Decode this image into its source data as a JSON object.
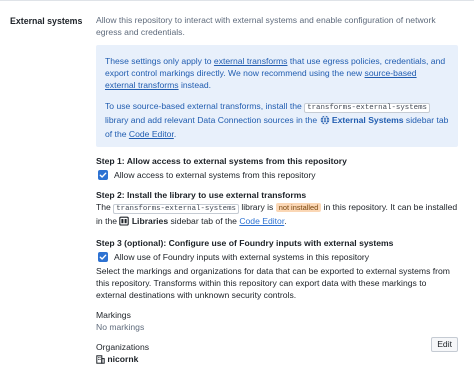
{
  "section": {
    "label": "External systems"
  },
  "intro": "Allow this repository to interact with external systems and enable configuration of network egress and credentials.",
  "callout": {
    "p1_a": "These settings only apply to ",
    "p1_link": "external transforms",
    "p1_b": " that use egress policies, credentials, and export control markings directly. We now recommend using the new ",
    "p1_link2": "source-based external transforms",
    "p1_c": " instead.",
    "p2_a": "To use source-based external transforms, install the ",
    "p2_code": "transforms-external-systems",
    "p2_b": " library and add relevant Data Connection sources in the ",
    "p2_bold": "External Systems",
    "p2_c": " sidebar tab of the ",
    "p2_link": "Code Editor",
    "p2_d": "."
  },
  "step1": {
    "title": "Step 1: Allow access to external systems from this repository",
    "checkbox_label": "Allow access to external systems from this repository",
    "checked": true
  },
  "step2": {
    "title": "Step 2: Install the library to use external transforms",
    "a": "The ",
    "code": "transforms-external-systems",
    "b": " library is ",
    "badge": "not installed",
    "c": " in this repository. It can be installed in the ",
    "bold": "Libraries",
    "d": " sidebar tab of the ",
    "link": "Code Editor",
    "e": "."
  },
  "step3": {
    "title": "Step 3 (optional): Configure use of Foundry inputs with external systems",
    "checkbox_label": "Allow use of Foundry inputs with external systems in this repository",
    "checked": true,
    "desc": "Select the markings and organizations for data that can be exported to external systems from this repository. Transforms within this repository can export data with these markings to external destinations with unknown security controls."
  },
  "markings": {
    "label": "Markings",
    "value": "No markings"
  },
  "organizations": {
    "label": "Organizations",
    "value": "nicornk"
  },
  "icons": [
    "globe-icon",
    "library-icon",
    "checkmark-icon",
    "organization-icon"
  ],
  "actions": {
    "edit_label": "Edit"
  }
}
